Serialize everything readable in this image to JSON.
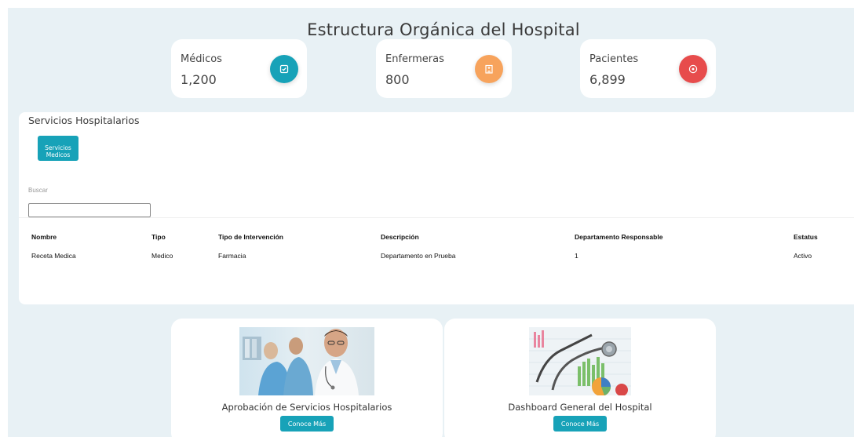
{
  "header": {
    "title": "Estructura Orgánica del Hospital"
  },
  "stats": [
    {
      "label": "Médicos",
      "value": "1,200",
      "icon": "clipboard-check-icon",
      "color": "#17a2b8"
    },
    {
      "label": "Enfermeras",
      "value": "800",
      "icon": "hospital-icon",
      "color": "#f7a35c"
    },
    {
      "label": "Pacientes",
      "value": "6,899",
      "icon": "user-circle-icon",
      "color": "#e74c4c"
    }
  ],
  "services": {
    "title": "Servicios Hospitalarios",
    "button_line1": "Servicios",
    "button_line2": "Medicos",
    "search_label": "Buscar",
    "search_value": "",
    "search_placeholder": ""
  },
  "table": {
    "headers": [
      "Nombre",
      "Tipo",
      "Tipo de Intervención",
      "Descripción",
      "Departamento Responsable",
      "Estatus"
    ],
    "rows": [
      [
        "Receta Medica",
        "Medico",
        "Farmacia",
        "Departamento en Prueba",
        "1",
        "Activo"
      ]
    ]
  },
  "cards": [
    {
      "title": "Aprobación de Servicios Hospitalarios",
      "button": "Conoce Más",
      "image": "doctor-photo"
    },
    {
      "title": "Dashboard General del Hospital",
      "button": "Conoce Más",
      "image": "stethoscope-chart-photo"
    }
  ],
  "colors": {
    "accent": "#17a2b8",
    "background": "#e8f1f5"
  }
}
